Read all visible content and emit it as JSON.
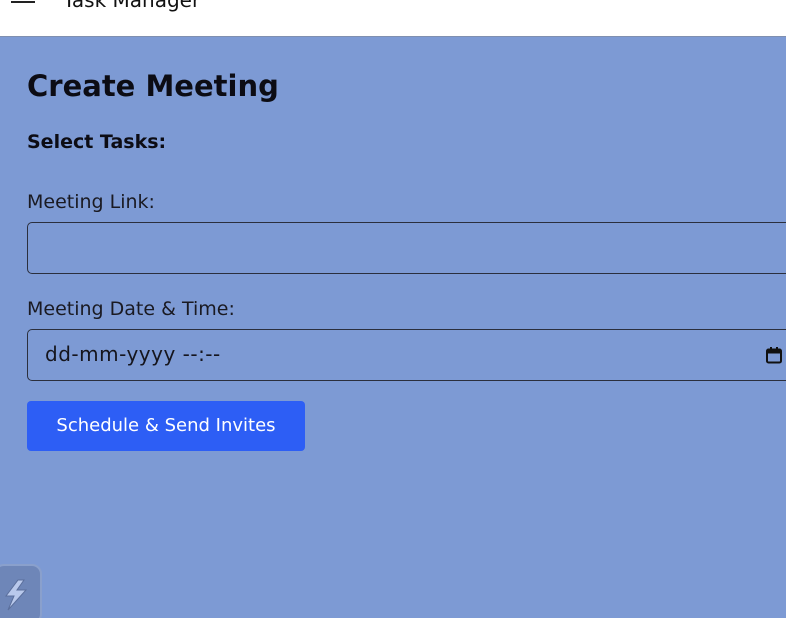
{
  "header": {
    "title": "Task Manager",
    "menu_icon": "hamburger-menu-icon"
  },
  "form": {
    "title": "Create Meeting",
    "select_tasks_label": "Select Tasks:",
    "meeting_link_label": "Meeting Link:",
    "meeting_link_value": "",
    "datetime_label": "Meeting Date & Time:",
    "datetime_placeholder": "dd-mm-yyyy --:--",
    "calendar_icon": "calendar-icon",
    "submit_label": "Schedule & Send Invites"
  },
  "widget": {
    "icon": "lightning-bolt-icon"
  },
  "colors": {
    "background": "#7d9ad4",
    "primary_button": "#2d5ef5",
    "header_bg": "#ffffff"
  }
}
